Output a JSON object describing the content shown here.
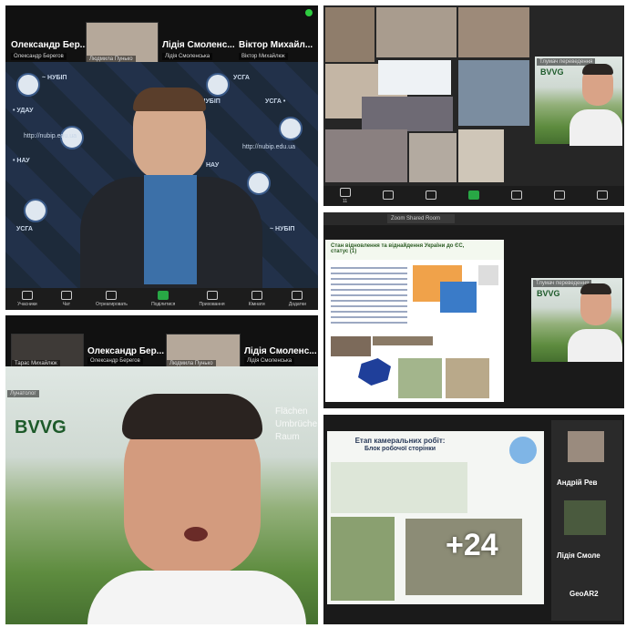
{
  "p1": {
    "tiles": [
      {
        "name": "Олександр Бер...",
        "sub": "Олександр Берегов"
      },
      {
        "name": "",
        "sub": "Людмила Пунько"
      },
      {
        "name": "Лідія Смоленс...",
        "sub": "Лідія Смоленська"
      },
      {
        "name": "Віктор Михайл...",
        "sub": "Віктор Михайлюк"
      }
    ],
    "watermarks": [
      "~ НУБІП",
      "УСГА",
      "• УДАУ",
      "• НАУ",
      "• НУБІП",
      "http://nubip.edu.ua",
      "УСГА •",
      "http://nubip.edu.ua",
      "НАУ",
      "УСГА",
      "~ НУБІП"
    ],
    "toolbar": [
      "Учасники",
      "Чат",
      "Отреагировать",
      "Поділитися",
      "Приховання",
      "Кімнати",
      "Додатки"
    ]
  },
  "p2": {
    "speaker_label": "Тлумач переведення",
    "brand": "BVVG",
    "toolbar_count": "11"
  },
  "p3": {
    "tab": "Zoom Shared Room",
    "slide_title": "Стан відновлення та віднайдення України до ЄС, статус (1)",
    "brand": "BVVG",
    "speaker_label": "Тлумач переведення"
  },
  "p4": {
    "tiles": [
      {
        "name": "",
        "sub": "Тарас Михайлюк"
      },
      {
        "name": "Олександр Бер...",
        "sub": "Олександр Берегов"
      },
      {
        "name": "",
        "sub": "Людмила Пунько"
      },
      {
        "name": "Лідія Смоленс...",
        "sub": "Лідія Смоленська"
      }
    ],
    "speaker_label": "Лунатолог",
    "brand": "BVVG",
    "bg_text": [
      "Flächen",
      "Umbrüche",
      "Raum"
    ]
  },
  "p5": {
    "slide_title": "Етап камеральних робіт:",
    "slide_subtitle": "Блок робочої сторінки",
    "overlay": "+24",
    "side_names": [
      "Андрій Рев",
      "Лідія Смоле",
      "GeoAR2"
    ]
  }
}
